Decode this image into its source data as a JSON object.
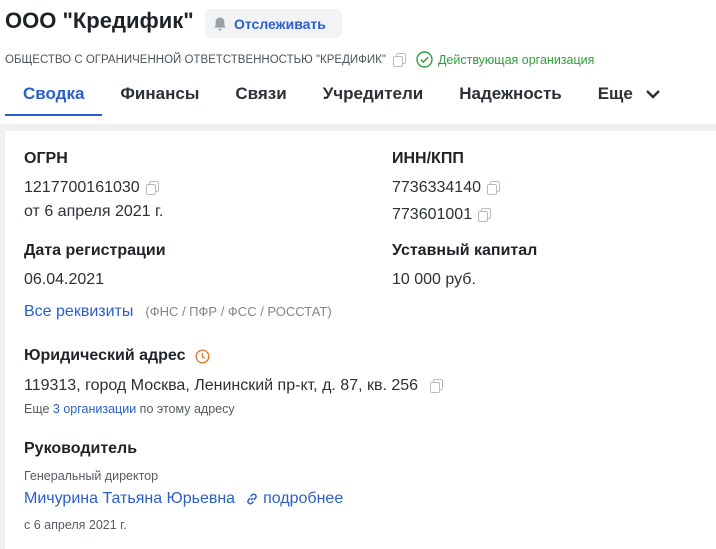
{
  "header": {
    "title": "ООО \"Кредифик\"",
    "follow_label": "Отслеживать",
    "full_name": "ОБЩЕСТВО С ОГРАНИЧЕННОЙ ОТВЕТСТВЕННОСТЬЮ \"КРЕДИФИК\"",
    "status": "Действующая организация"
  },
  "tabs": [
    "Сводка",
    "Финансы",
    "Связи",
    "Учредители",
    "Надежность",
    "Еще"
  ],
  "summary": {
    "ogrn_label": "ОГРН",
    "ogrn": "1217700161030",
    "ogrn_date": "от 6 апреля 2021 г.",
    "inn_kpp_label": "ИНН/КПП",
    "inn": "7736334140",
    "kpp": "773601001",
    "reg_date_label": "Дата регистрации",
    "reg_date": "06.04.2021",
    "capital_label": "Уставный капитал",
    "capital": "10 000 руб.",
    "all_details_link": "Все реквизиты",
    "details_sources": "(ФНС / ПФР / ФСС / РОССТАТ)",
    "address_label": "Юридический адрес",
    "address": "119313, город Москва, Ленинский пр-кт, д. 87, кв. 256",
    "address_note_prefix": "Еще",
    "address_note_link": "3 организации",
    "address_note_suffix": "по этому адресу",
    "head_label": "Руководитель",
    "head_position": "Генеральный директор",
    "head_name": "Мичурина Татьяна Юрьевна",
    "head_more": "подробнее",
    "head_since": "с 6 апреля 2021 г."
  },
  "colors": {
    "accent": "#2a5fc9",
    "status_green": "#2e9e3e",
    "warning_orange": "#e07b2e"
  }
}
